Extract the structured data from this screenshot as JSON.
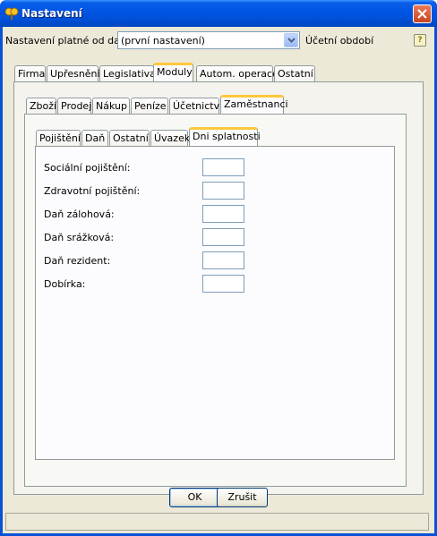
{
  "window": {
    "title": "Nastavení"
  },
  "header": {
    "date_label": "Nastavení platné od data:",
    "date_value": "(první nastavení)",
    "period_label": "Účetní období",
    "help_glyph": "?"
  },
  "main_tabs": [
    "Firma",
    "Upřesnění",
    "Legislativa",
    "Moduly",
    "Autom. operace",
    "Ostatní"
  ],
  "module_tabs": [
    "Zboží",
    "Prodej",
    "Nákup",
    "Peníze",
    "Účetnictví",
    "Zaměstnanci"
  ],
  "employee_tabs": [
    "Pojištění",
    "Daň",
    "Ostatní",
    "Úvazek",
    "Dni splatnosti"
  ],
  "fields": [
    {
      "label": "Sociální pojištění:",
      "value": ""
    },
    {
      "label": "Zdravotní pojištění:",
      "value": ""
    },
    {
      "label": "Daň zálohová:",
      "value": ""
    },
    {
      "label": "Daň srážková:",
      "value": ""
    },
    {
      "label": "Daň rezident:",
      "value": ""
    },
    {
      "label": "Dobírka:",
      "value": ""
    }
  ],
  "buttons": {
    "ok": "OK",
    "cancel": "Zrušit"
  },
  "colors": {
    "titlebar": "#0054e3",
    "active_tab_accent": "#ffc83c",
    "dialog_bg": "#ece9d8"
  }
}
